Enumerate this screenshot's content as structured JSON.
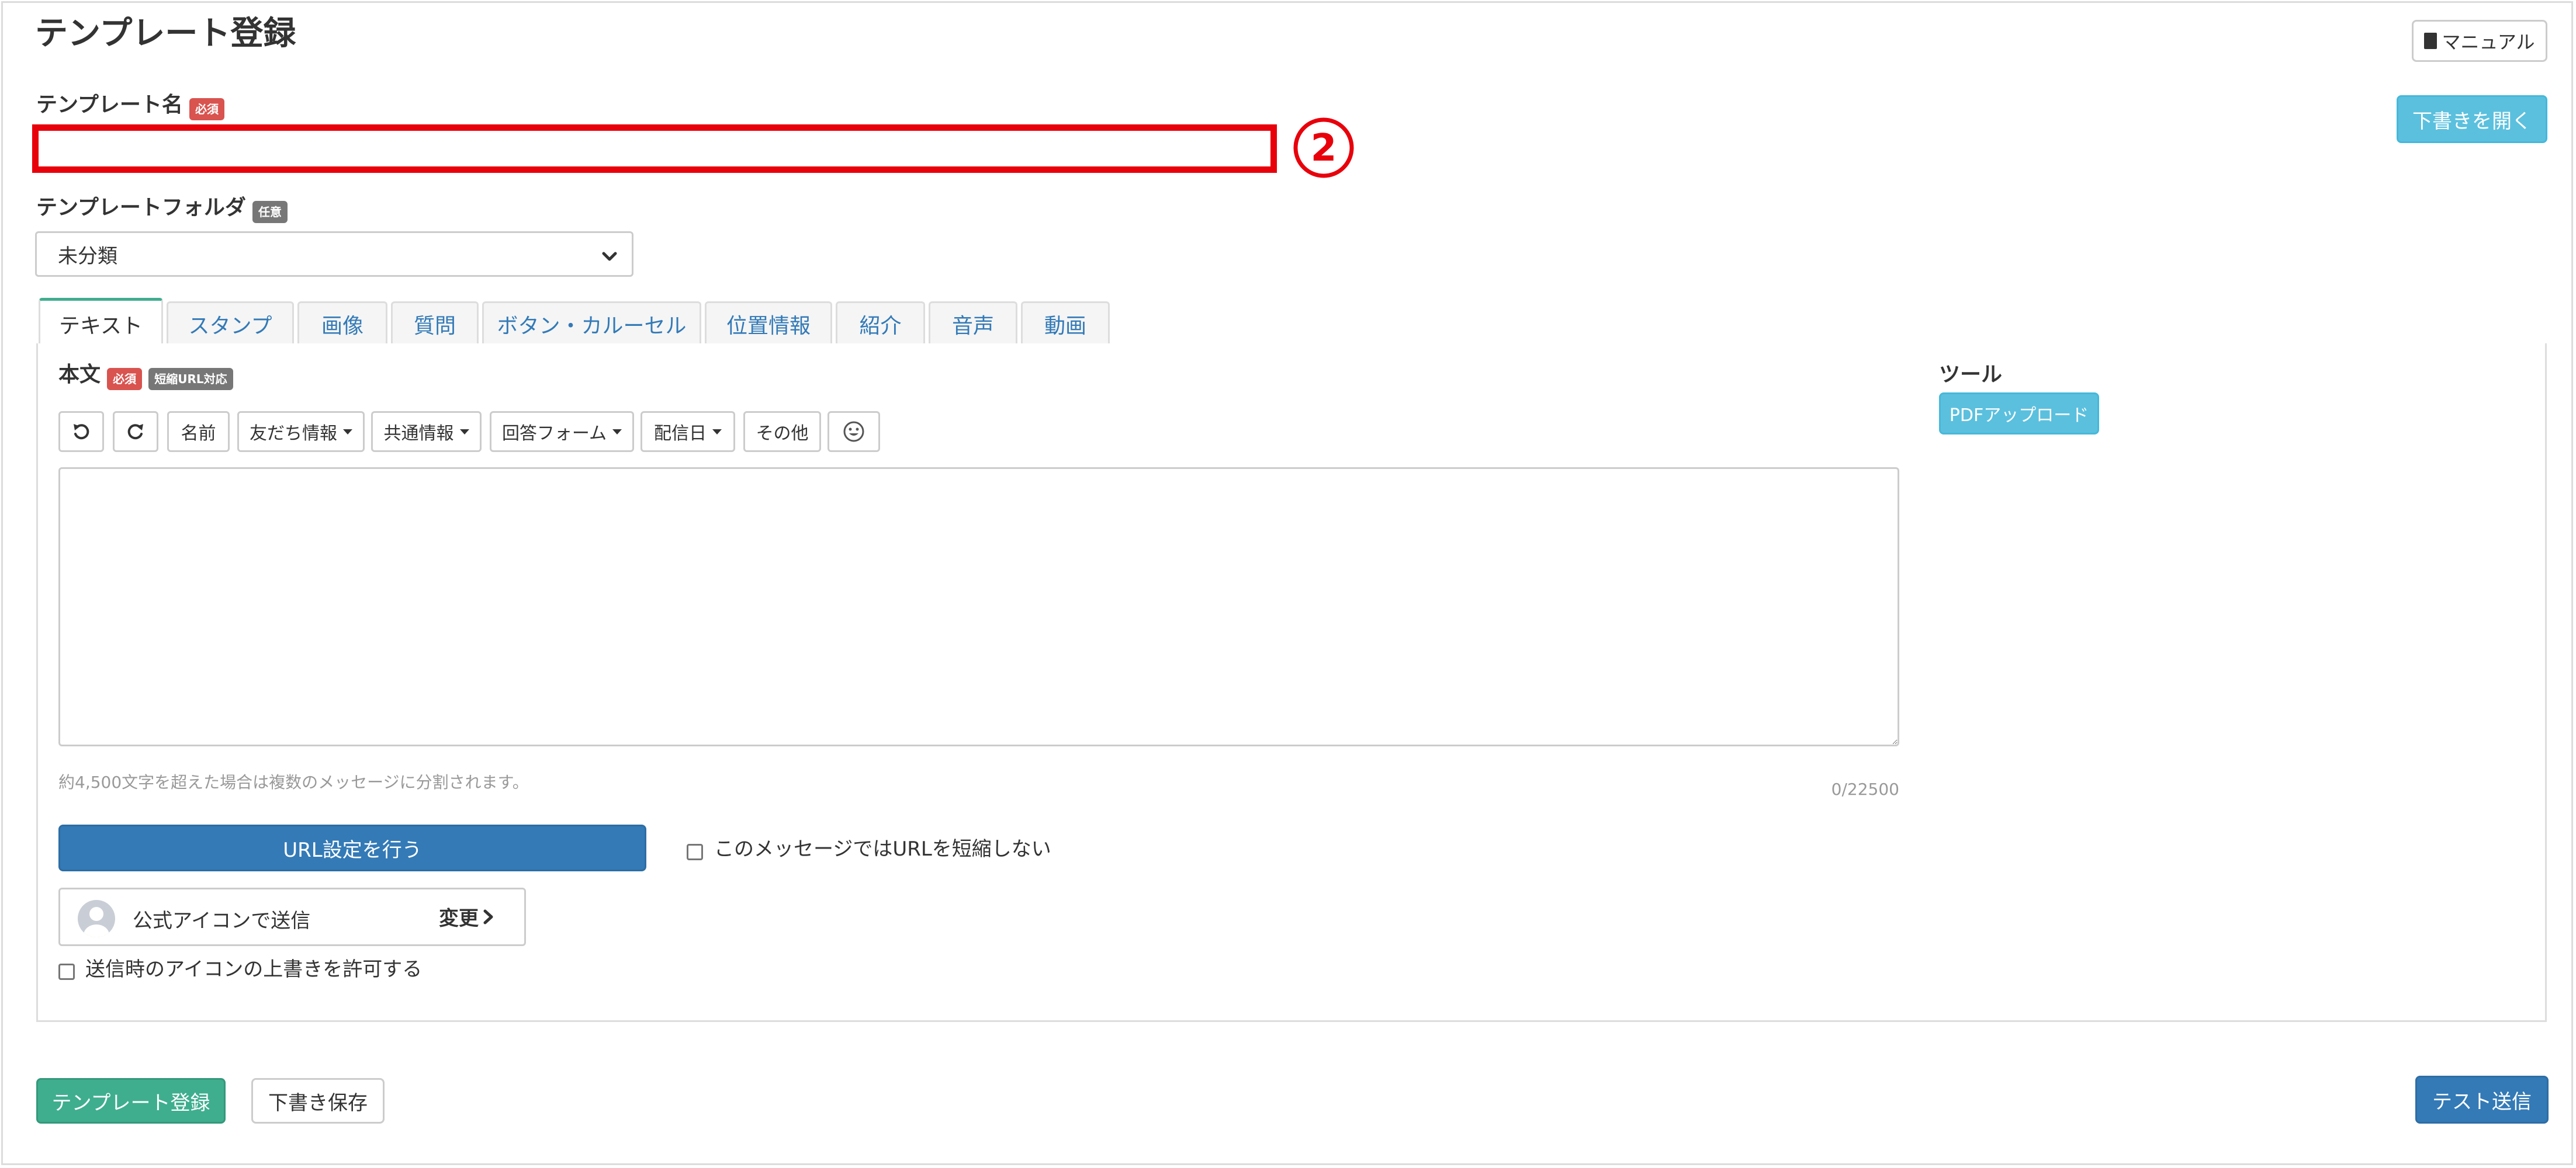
{
  "page": {
    "title": "テンプレート登録",
    "manual_button": "マニュアル",
    "open_draft_button": "下書きを開く"
  },
  "template_name": {
    "label": "テンプレート名",
    "badge": "必須",
    "value": "",
    "annotation_number": "②"
  },
  "template_folder": {
    "label": "テンプレートフォルダ",
    "badge": "任意",
    "selected": "未分類"
  },
  "tabs": [
    {
      "label": "テキスト",
      "active": true
    },
    {
      "label": "スタンプ"
    },
    {
      "label": "画像"
    },
    {
      "label": "質問"
    },
    {
      "label": "ボタン・カルーセル"
    },
    {
      "label": "位置情報"
    },
    {
      "label": "紹介"
    },
    {
      "label": "音声"
    },
    {
      "label": "動画"
    }
  ],
  "body": {
    "label": "本文",
    "badge_required": "必須",
    "badge_short_url": "短縮URL対応",
    "toolbar": {
      "undo_icon": "undo-icon",
      "redo_icon": "redo-icon",
      "name": "名前",
      "friend_info": "友だち情報",
      "common_info": "共通情報",
      "answer_form": "回答フォーム",
      "delivery_date": "配信日",
      "other": "その他",
      "emoji_icon": "smiley-icon"
    },
    "text_value": "",
    "hint": "約4,500文字を超えた場合は複数のメッセージに分割されます。",
    "counter": "0/22500"
  },
  "tools": {
    "label": "ツール",
    "pdf_upload": "PDFアップロード"
  },
  "url_settings": {
    "button": "URL設定を行う",
    "no_shorten_label": "このメッセージではURLを短縮しない",
    "no_shorten_checked": false
  },
  "sender_icon": {
    "label": "公式アイコンで送信",
    "change_label": "変更",
    "allow_override_label": "送信時のアイコンの上書きを許可する",
    "allow_override_checked": false
  },
  "footer": {
    "register_button": "テンプレート登録",
    "save_draft_button": "下書き保存",
    "test_send_button": "テスト送信"
  },
  "colors": {
    "highlight": "#e8000b",
    "required_badge": "#d9534f",
    "optional_badge": "#777777",
    "info_button": "#5bc0de",
    "primary_button": "#337ab7",
    "success_button": "#3fae8e",
    "active_tab_accent": "#3fae8e"
  }
}
